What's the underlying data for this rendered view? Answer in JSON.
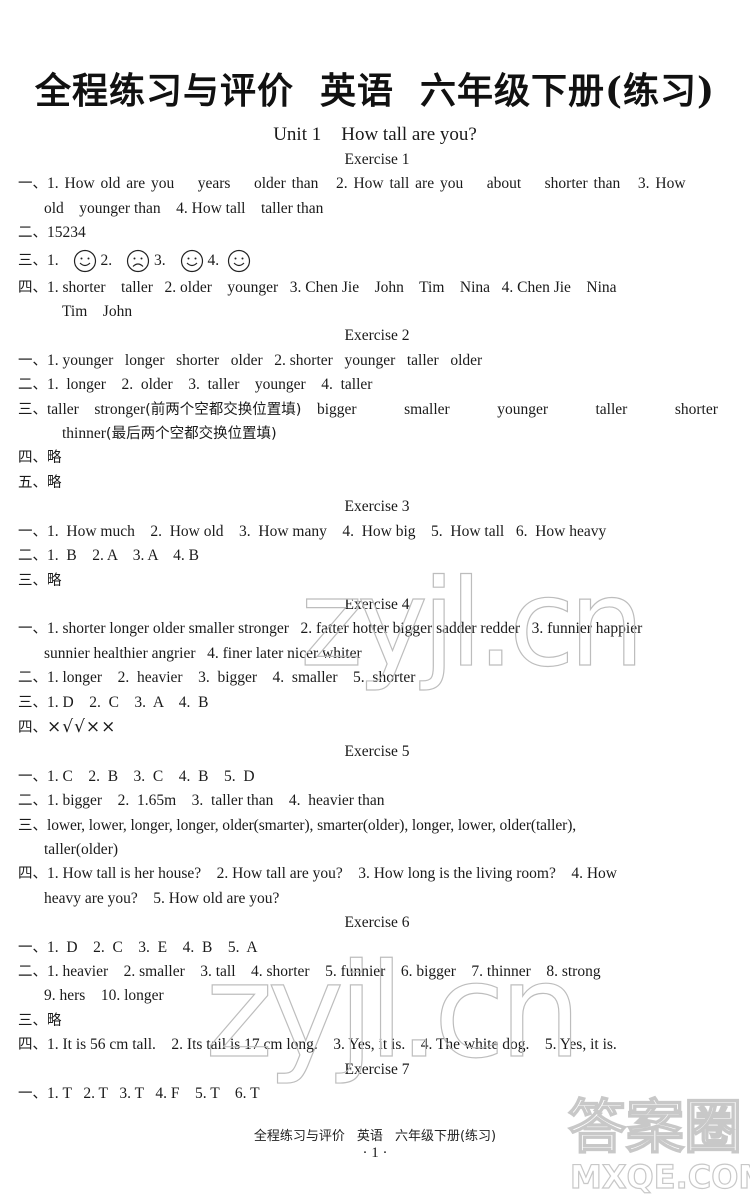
{
  "header": {
    "title_parts": [
      "全程练习与评价",
      "英语",
      "六年级下册(练习)"
    ],
    "unit_label": "Unit 1",
    "unit_title": "How tall are you?"
  },
  "exercises": [
    {
      "heading": "Exercise 1",
      "items": [
        {
          "prefix": "一、",
          "lines": [
            "1. How old are you    years    older than   2. How tall are you    about    shorter than   3. How",
            "old    younger than    4. How tall    taller than"
          ]
        },
        {
          "prefix": "二、",
          "lines": [
            "15234"
          ]
        },
        {
          "prefix": "三、",
          "faces": [
            {
              "label": "1.",
              "type": "smile"
            },
            {
              "label": "2.",
              "type": "frown"
            },
            {
              "label": "3.",
              "type": "smile"
            },
            {
              "label": "4.",
              "type": "smile"
            }
          ]
        },
        {
          "prefix": "四、",
          "lines": [
            "1. shorter    taller   2. older    younger   3. Chen Jie    John    Tim    Nina   4. Chen Jie    Nina",
            "Tim    John"
          ]
        }
      ]
    },
    {
      "heading": "Exercise 2",
      "items": [
        {
          "prefix": "一、",
          "lines": [
            "1. younger   longer   shorter   older   2. shorter   younger   taller   older"
          ]
        },
        {
          "prefix": "二、",
          "lines": [
            "1.  longer    2.  older    3.  taller    younger    4.  taller"
          ]
        },
        {
          "prefix": "三、",
          "lines": [
            "taller    stronger",
            "bigger    smaller    younger    taller    shorter",
            "thinner"
          ],
          "notes": [
            "(前两个空都交换位置填)",
            "(最后两个空都交换位置填)"
          ]
        },
        {
          "prefix": "四、",
          "lines": [
            "略"
          ]
        },
        {
          "prefix": "五、",
          "lines": [
            "略"
          ]
        }
      ]
    },
    {
      "heading": "Exercise 3",
      "items": [
        {
          "prefix": "一、",
          "lines": [
            "1.  How much    2.  How old    3.  How many    4.  How big    5.  How tall   6.  How heavy"
          ]
        },
        {
          "prefix": "二、",
          "lines": [
            "1.  B    2. A    3. A    4. B"
          ]
        },
        {
          "prefix": "三、",
          "lines": [
            "略"
          ]
        }
      ]
    },
    {
      "heading": "Exercise 4",
      "items": [
        {
          "prefix": "一、",
          "lines": [
            "1. shorter longer older smaller stronger   2. fatter hotter bigger sadder redder   3. funnier happier",
            "sunnier healthier angrier   4. finer later nicer whiter"
          ]
        },
        {
          "prefix": "二、",
          "lines": [
            "1. longer    2.  heavier    3.  bigger    4.  smaller    5.  shorter"
          ]
        },
        {
          "prefix": "三、",
          "lines": [
            "1. D    2.  C    3.  A    4.  B"
          ]
        },
        {
          "prefix": "四、",
          "lines": [
            "×√√××"
          ]
        }
      ]
    },
    {
      "heading": "Exercise 5",
      "items": [
        {
          "prefix": "一、",
          "lines": [
            "1. C    2.  B    3.  C    4.  B    5.  D"
          ]
        },
        {
          "prefix": "二、",
          "lines": [
            "1. bigger    2.  1.65m    3.  taller than    4.  heavier than"
          ]
        },
        {
          "prefix": "三、",
          "lines": [
            "lower, lower, longer, longer, older(smarter), smarter(older), longer, lower, older(taller),",
            "taller(older)"
          ]
        },
        {
          "prefix": "四、",
          "lines": [
            "1. How tall is her house?    2. How tall are you?    3. How long is the living room?    4. How",
            "heavy are you?    5. How old are you?"
          ]
        }
      ]
    },
    {
      "heading": "Exercise 6",
      "items": [
        {
          "prefix": "一、",
          "lines": [
            "1.  D    2.  C    3.  E    4.  B    5.  A"
          ]
        },
        {
          "prefix": "二、",
          "lines": [
            "1. heavier    2. smaller    3. tall    4. shorter    5. funnier    6. bigger    7. thinner    8. strong",
            "9. hers    10. longer"
          ]
        },
        {
          "prefix": "三、",
          "lines": [
            "略"
          ]
        },
        {
          "prefix": "四、",
          "lines": [
            "1. It is 56 cm tall.    2. Its tail is 17 cm long.    3. Yes, it is.    4. The white dog.    5. Yes, it is."
          ]
        }
      ]
    },
    {
      "heading": "Exercise 7",
      "items": [
        {
          "prefix": "一、",
          "lines": [
            "1. T   2. T   3. T   4. F    5. T    6. T"
          ]
        }
      ]
    }
  ],
  "footer": {
    "parts": [
      "全程练习与评价",
      "英语",
      "六年级下册(练习)"
    ],
    "page_number": "· 1 ·"
  },
  "watermarks": {
    "site_mark": "zyjl.cn",
    "corner_mark_top": "答案圈",
    "corner_mark_bottom": "MXQE.COM"
  }
}
